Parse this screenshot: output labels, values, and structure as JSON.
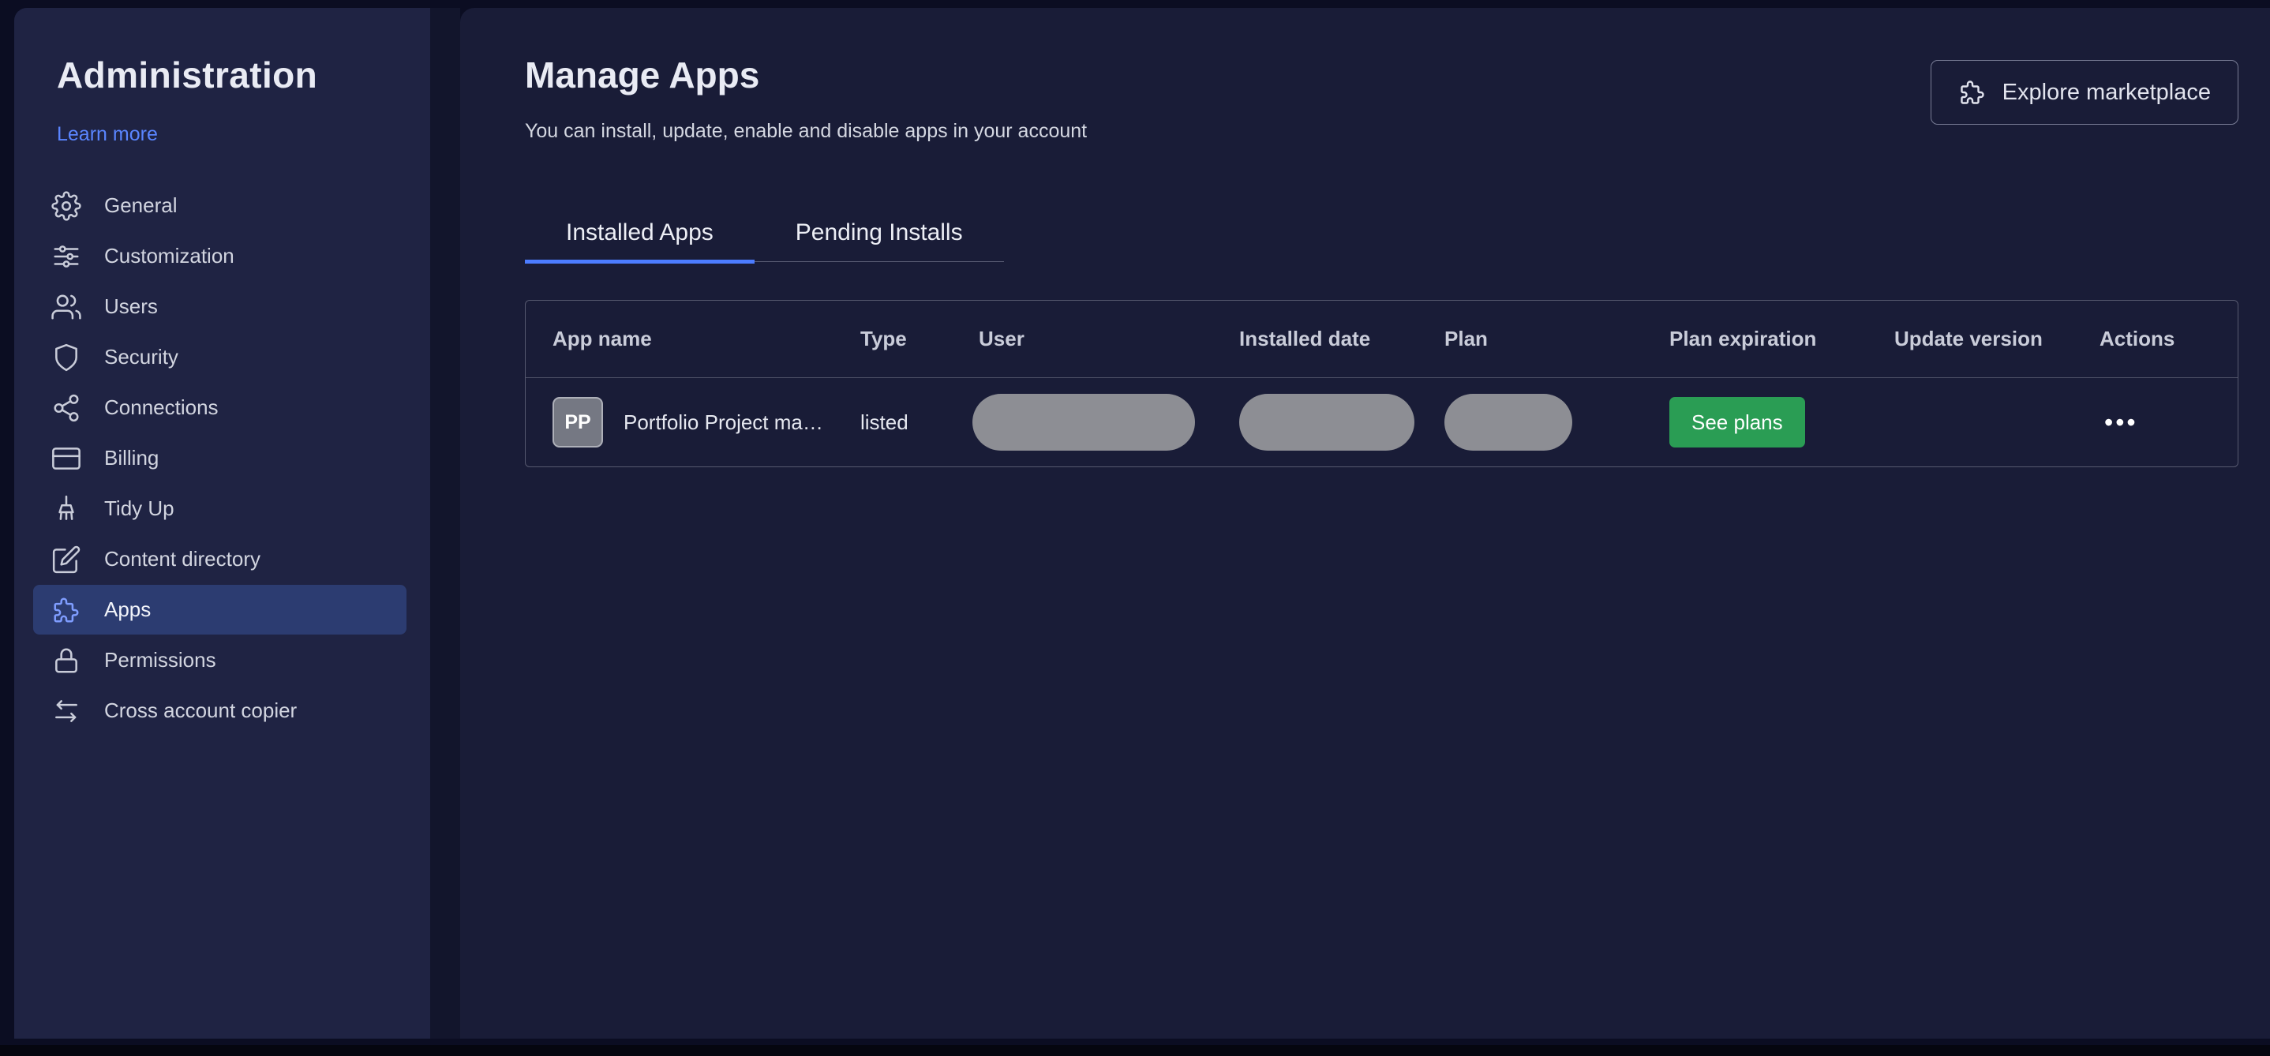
{
  "colors": {
    "accent_blue": "#4c7cff",
    "link_blue": "#5a85ff",
    "active_item_bg": "#2c3c71",
    "success_green": "#2a9d54",
    "sidebar_bg": "#1f2343",
    "main_bg": "#191c37"
  },
  "sidebar": {
    "title": "Administration",
    "learn_more_label": "Learn more",
    "items": [
      {
        "label": "General",
        "icon": "gear-icon",
        "active": false
      },
      {
        "label": "Customization",
        "icon": "sliders-icon",
        "active": false
      },
      {
        "label": "Users",
        "icon": "users-icon",
        "active": false
      },
      {
        "label": "Security",
        "icon": "shield-icon",
        "active": false
      },
      {
        "label": "Connections",
        "icon": "nodes-icon",
        "active": false
      },
      {
        "label": "Billing",
        "icon": "credit-card-icon",
        "active": false
      },
      {
        "label": "Tidy Up",
        "icon": "broom-icon",
        "active": false
      },
      {
        "label": "Content directory",
        "icon": "document-edit-icon",
        "active": false
      },
      {
        "label": "Apps",
        "icon": "puzzle-icon",
        "active": true
      },
      {
        "label": "Permissions",
        "icon": "lock-icon",
        "active": false
      },
      {
        "label": "Cross account copier",
        "icon": "transfer-arrows-icon",
        "active": false
      }
    ]
  },
  "main": {
    "title": "Manage Apps",
    "subtitle": "You can install, update, enable and disable apps in your account",
    "explore_button_label": "Explore marketplace",
    "tabs": [
      {
        "label": "Installed Apps",
        "active": true
      },
      {
        "label": "Pending Installs",
        "active": false
      }
    ],
    "table": {
      "headers": [
        "App name",
        "Type",
        "User",
        "Installed date",
        "Plan",
        "Plan expiration",
        "Update version",
        "Actions"
      ],
      "row": {
        "avatar_initials": "PP",
        "app_name": "Portfolio Project ma…",
        "type": "listed",
        "user_redacted": true,
        "installed_date_redacted": true,
        "plan_redacted": true,
        "plan_expiration_button": "See plans",
        "actions_icon": "•••"
      }
    }
  }
}
